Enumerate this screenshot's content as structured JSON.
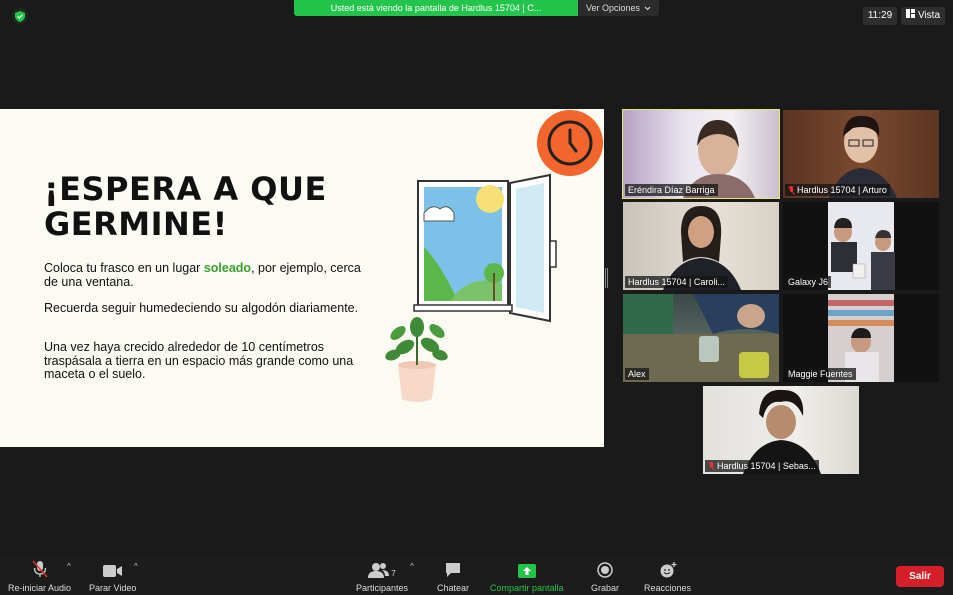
{
  "top": {
    "share_message": "Usted está viendo la pantalla de Hardlus 15704 | C...",
    "view_options": "Ver Opciones",
    "time": "11:29",
    "view_label": "Vista"
  },
  "slide": {
    "title": "¡ESPERA A QUE GERMINE!",
    "p1_before": "Coloca tu frasco en un lugar ",
    "p1_highlight": "soleado",
    "p1_after": ", por ejemplo, cerca de una ventana.",
    "p2": "Recuerda seguir humedeciendo su algodón diariamente.",
    "p3": "Una vez haya crecido alrededor de 10 centímetros traspásala a tierra en un espacio más grande como una maceta o el suelo.",
    "highlight_color": "#39a12d"
  },
  "participants": [
    {
      "name": "Eréndira Díaz Barriga",
      "muted": false,
      "active": true
    },
    {
      "name": "Hardlus 15704 | Arturo",
      "muted": true,
      "active": false
    },
    {
      "name": "Hardlus 15704 | Caroli...",
      "muted": false,
      "active": false
    },
    {
      "name": "Galaxy J6",
      "muted": false,
      "active": false
    },
    {
      "name": "Alex",
      "muted": false,
      "active": false
    },
    {
      "name": "Maggie Fuentes",
      "muted": false,
      "active": false
    },
    {
      "name": "Hardlus 15704 | Sebas...",
      "muted": true,
      "active": false
    }
  ],
  "toolbar": {
    "audio": "Re-iniciar Audio",
    "video": "Parar Video",
    "participants": "Participantes",
    "participants_count": "7",
    "chat": "Chatear",
    "share": "Compartir pantalla",
    "record": "Grabar",
    "reactions": "Reacciones",
    "leave": "Salir"
  },
  "colors": {
    "share_green": "#23c44b",
    "leave_red": "#d5202a",
    "active_speaker": "#e8e86a"
  }
}
